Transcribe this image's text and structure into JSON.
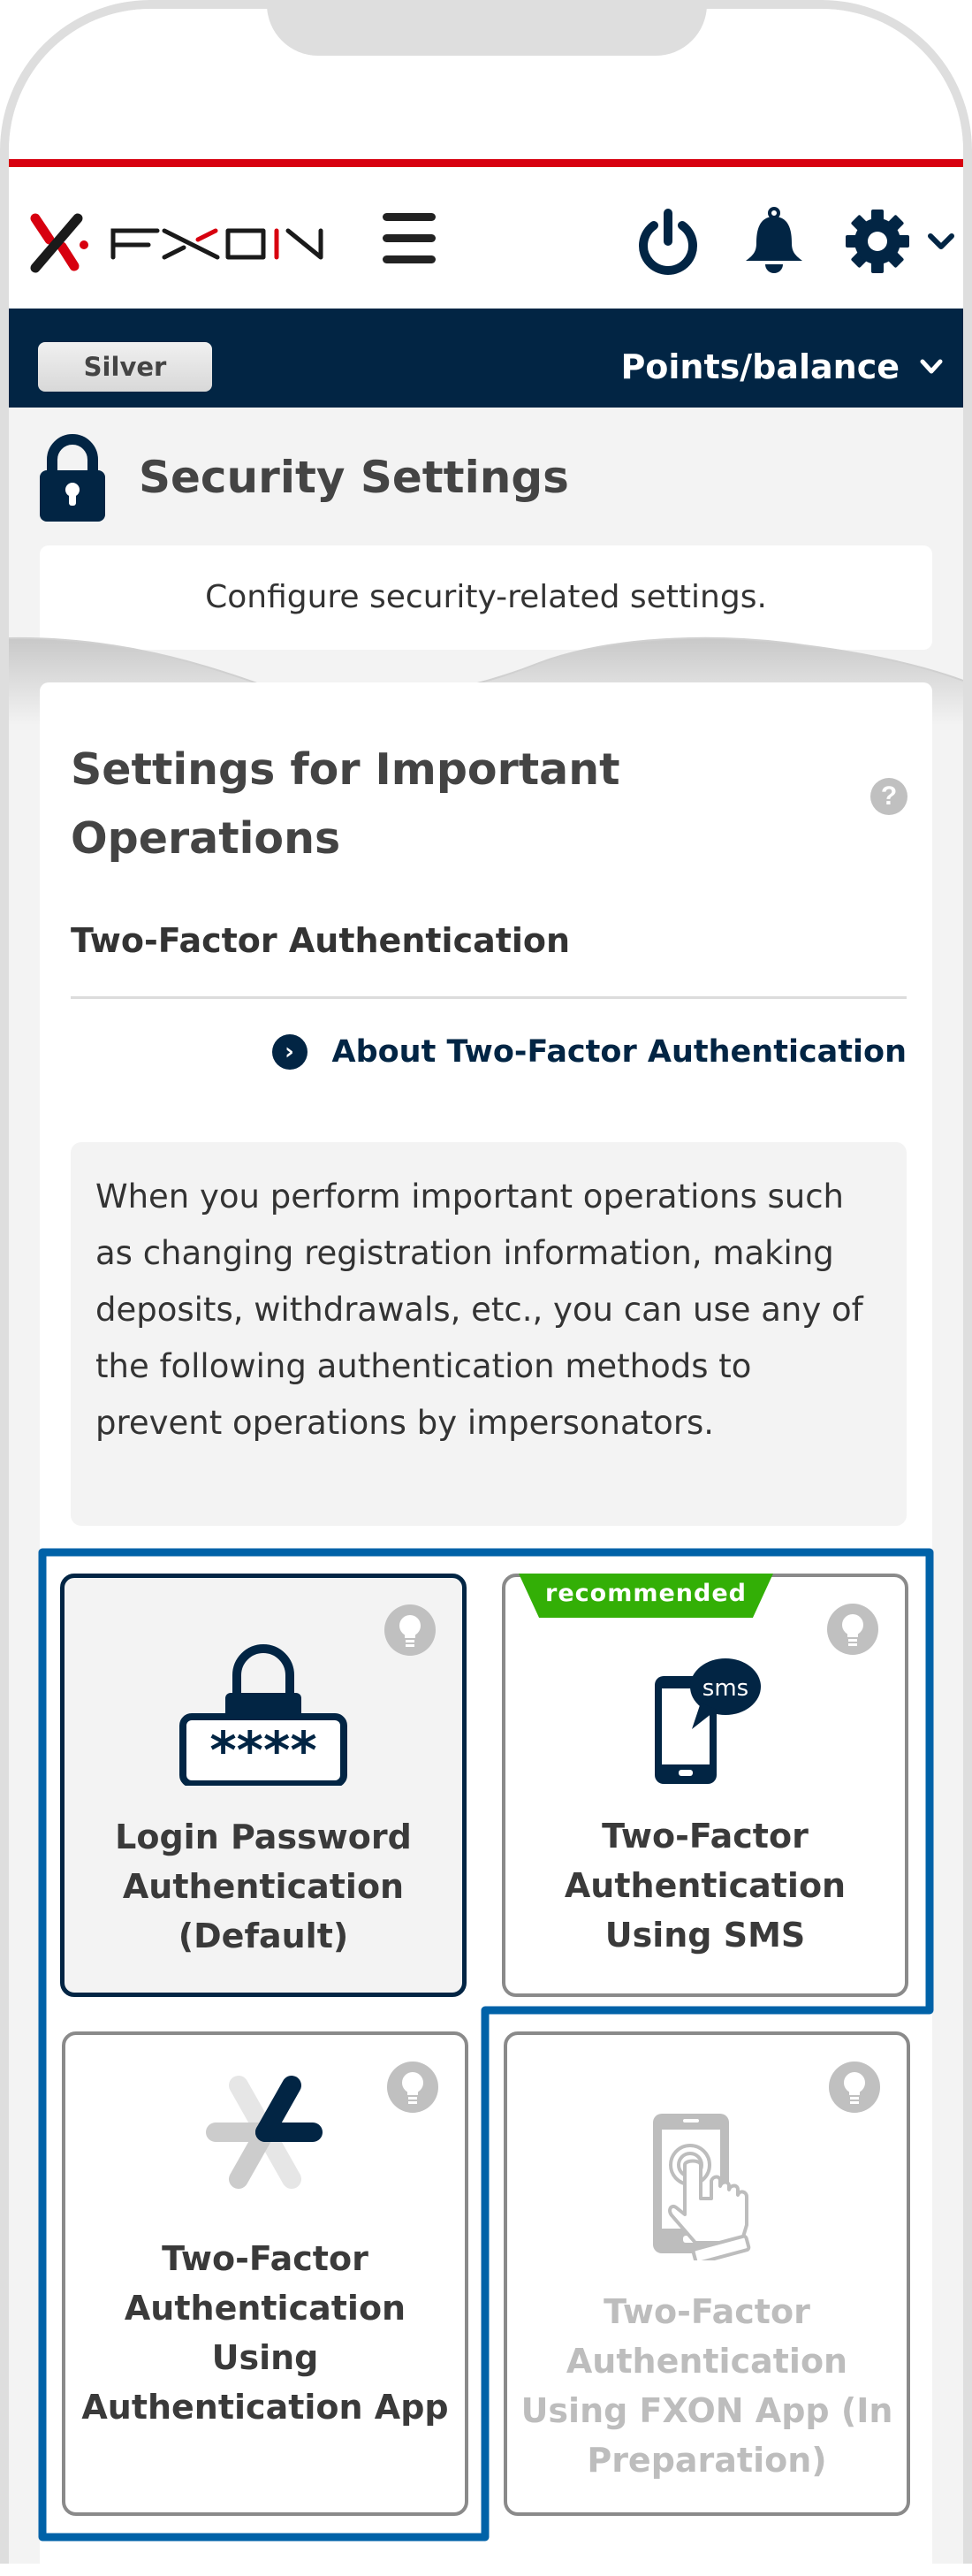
{
  "header": {
    "brand": "FXON",
    "icons": [
      "menu-icon",
      "power-icon",
      "bell-icon",
      "gear-icon",
      "chevron-down-icon"
    ]
  },
  "navbar": {
    "rank": "Silver",
    "points_label": "Points/balance"
  },
  "page": {
    "title": "Security Settings",
    "description": "Configure security-related settings."
  },
  "section": {
    "title": "Settings for Important Operations",
    "subtitle": "Two-Factor Authentication",
    "about_link": "About Two-Factor Authentication",
    "info": "When you perform important operations such as changing registration information, making deposits, withdrawals, etc., you can use any of the following authentication methods to prevent operations by impersonators."
  },
  "methods": [
    {
      "label": "Login Password Authentication (Default)",
      "state": "selected",
      "icon": "password-lock-icon",
      "badge": ""
    },
    {
      "label": "Two-Factor Authentication Using SMS",
      "state": "available",
      "icon": "sms-phone-icon",
      "badge": "recommended"
    },
    {
      "label": "Two-Factor Authentication Using Authentication App",
      "state": "available",
      "icon": "authenticator-app-icon",
      "badge": ""
    },
    {
      "label": "Two-Factor Authentication Using FXON App (In Preparation)",
      "state": "disabled",
      "icon": "touch-phone-icon",
      "badge": ""
    }
  ],
  "colors": {
    "brand_red": "#d7000f",
    "navy": "#022544",
    "highlight_blue": "#0062a8",
    "recommended_green": "#33af06",
    "disabled_gray": "#bdbdbd"
  }
}
